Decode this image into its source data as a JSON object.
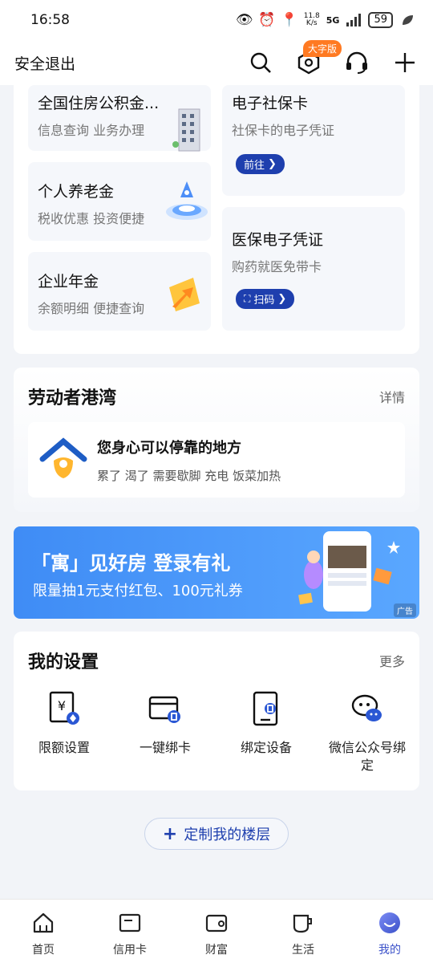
{
  "status_bar": {
    "time": "16:58",
    "net_speed": [
      "11.8",
      "K/s"
    ],
    "network": "5G",
    "battery": "59"
  },
  "header": {
    "logout": "安全退出",
    "badge": "大字版",
    "icons": [
      "search-icon",
      "hexagon-settings-icon",
      "headset-icon",
      "plus-icon"
    ]
  },
  "services": {
    "left": [
      {
        "title": "全国住房公积金...",
        "subtitle": "信息查询 业务办理"
      },
      {
        "title": "个人养老金",
        "subtitle": "税收优惠 投资便捷"
      },
      {
        "title": "企业年金",
        "subtitle": "余额明细 便捷查询"
      }
    ],
    "right": [
      {
        "title": "电子社保卡",
        "subtitle": "社保卡的电子凭证",
        "button": "前往"
      },
      {
        "title": "医保电子凭证",
        "subtitle": "购药就医免带卡",
        "button": "扫码"
      }
    ]
  },
  "harbor": {
    "title": "劳动者港湾",
    "more": "详情",
    "headline": "您身心可以停靠的地方",
    "desc": "累了 渴了 需要歇脚 充电 饭菜加热"
  },
  "banner": {
    "title": "「寓」见好房 登录有礼",
    "subtitle": "限量抽1元支付红包、100元礼券",
    "ad": "广告"
  },
  "settings": {
    "title": "我的设置",
    "more": "更多",
    "items": [
      {
        "label": "限额设置",
        "icon": "yen-limit-icon"
      },
      {
        "label": "一键绑卡",
        "icon": "wallet-card-icon"
      },
      {
        "label": "绑定设备",
        "icon": "phone-device-icon"
      },
      {
        "label": "微信公众号绑定",
        "icon": "wechat-icon"
      }
    ]
  },
  "custom_floor": {
    "label": "定制我的楼层"
  },
  "tabs": [
    {
      "label": "首页",
      "icon": "home-icon"
    },
    {
      "label": "信用卡",
      "icon": "credit-card-icon"
    },
    {
      "label": "财富",
      "icon": "wallet-icon"
    },
    {
      "label": "生活",
      "icon": "cup-icon"
    },
    {
      "label": "我的",
      "icon": "profile-face-icon",
      "active": true
    }
  ],
  "colors": {
    "brand": "#1e3fae",
    "accent": "#ff7a22",
    "banner": "#4a99fa",
    "active_tab": "#3b51c9"
  }
}
